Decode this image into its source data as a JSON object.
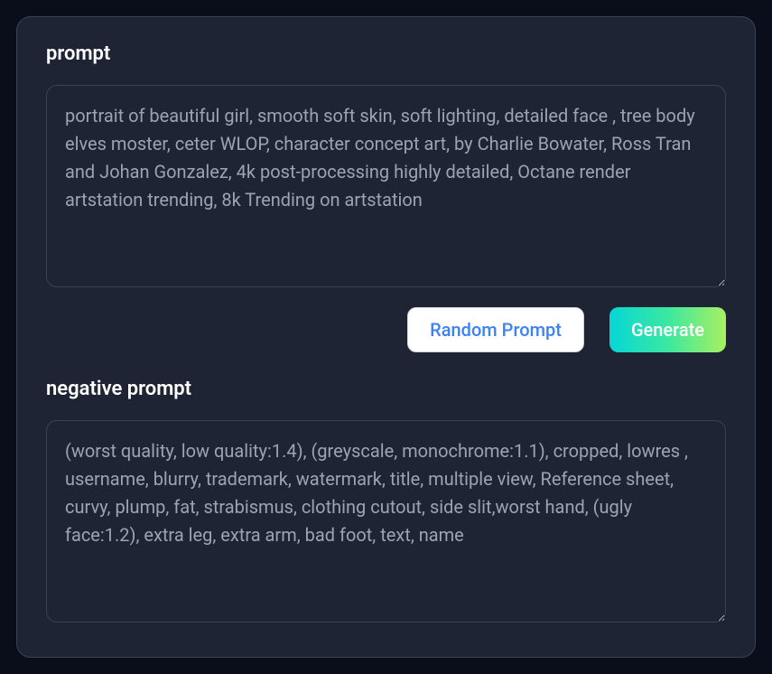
{
  "prompt": {
    "label": "prompt",
    "value": "portrait of beautiful girl, smooth soft skin, soft lighting, detailed face , tree body elves moster, ceter WLOP, character concept art, by Charlie Bowater, Ross Tran and Johan Gonzalez, 4k post-processing highly detailed, Octane render artstation trending, 8k Trending on artstation"
  },
  "buttons": {
    "random": "Random Prompt",
    "generate": "Generate"
  },
  "negative_prompt": {
    "label": "negative prompt",
    "value": "(worst quality, low quality:1.4), (greyscale, monochrome:1.1), cropped, lowres , username, blurry, trademark, watermark, title, multiple view, Reference sheet, curvy, plump, fat, strabismus, clothing cutout, side slit,worst hand, (ugly face:1.2), extra leg, extra arm, bad foot, text, name"
  }
}
